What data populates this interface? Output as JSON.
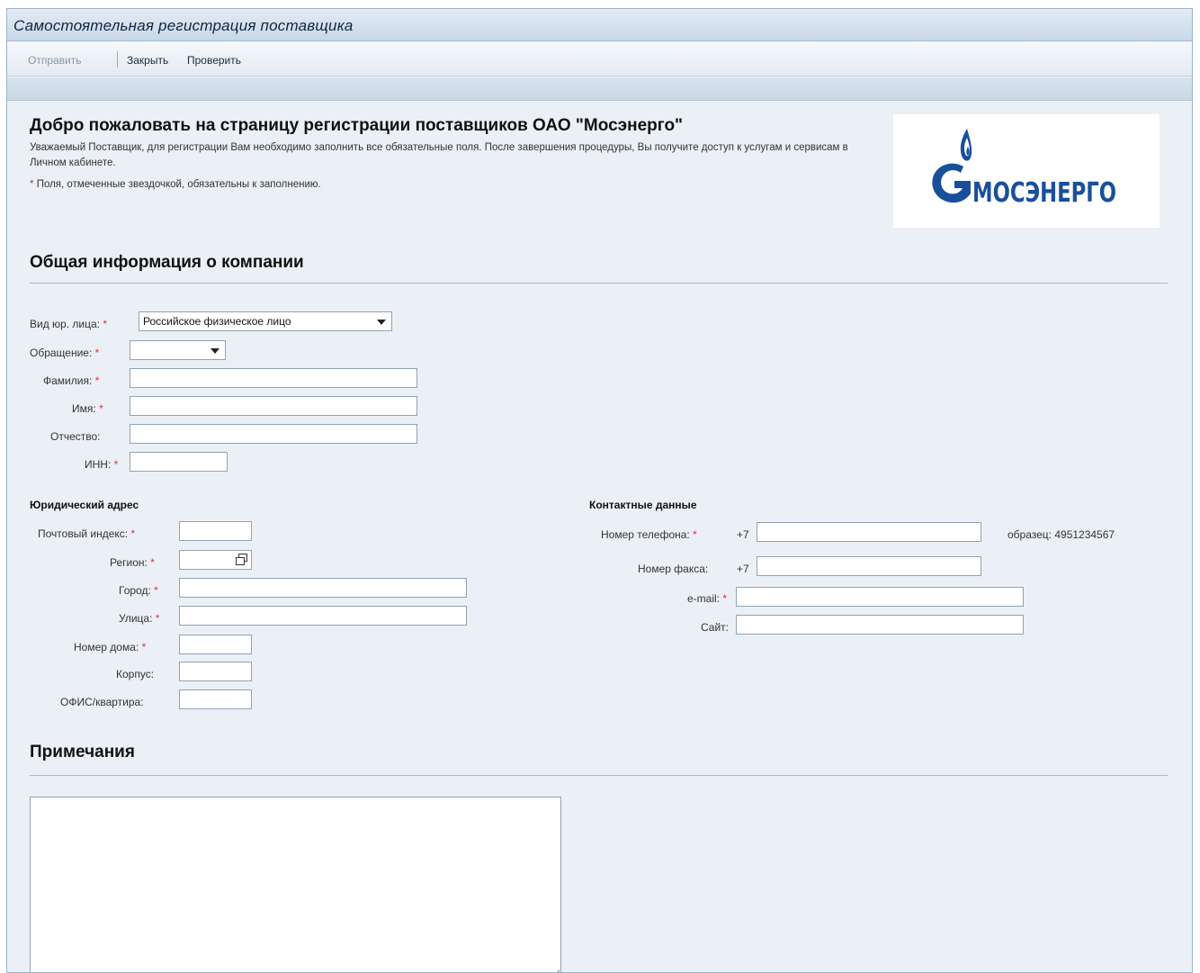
{
  "window": {
    "title": "Самостоятельная регистрация поставщика"
  },
  "toolbar": {
    "send": "Отправить",
    "close": "Закрыть",
    "check": "Проверить"
  },
  "welcome": {
    "title": "Добро пожаловать на страницу регистрации поставщиков ОАО \"Мосэнерго\"",
    "text": "Уважаемый Поставщик, для регистрации Вам необходимо заполнить все обязательные поля. После завершения процедуры, Вы получите доступ к услугам и сервисам в Личном кабинете.",
    "required_note": "Поля, отмеченные звездочкой, обязательны к заполнению.",
    "star": "*"
  },
  "logo": {
    "text": "МОСЭНЕРГО"
  },
  "company": {
    "section_title": "Общая информация о компании",
    "entity_type_label": "Вид юр. лица:",
    "entity_type_value": "Российское физическое лицо",
    "salutation_label": "Обращение:",
    "salutation_value": "",
    "lastname_label": "Фамилия:",
    "firstname_label": "Имя:",
    "middlename_label": "Отчество:",
    "inn_label": "ИНН:"
  },
  "address": {
    "title": "Юридический адрес",
    "postcode_label": "Почтовый индекс:",
    "region_label": "Регион:",
    "city_label": "Город:",
    "street_label": "Улица:",
    "house_label": "Номер дома:",
    "building_label": "Корпус:",
    "office_label": "ОФИС/квартира:"
  },
  "contacts": {
    "title": "Контактные данные",
    "phone_label": "Номер телефона:",
    "phone_prefix": "+7",
    "phone_hint": "образец: 4951234567",
    "fax_label": "Номер факса:",
    "fax_prefix": "+7",
    "email_label": "e-mail:",
    "site_label": "Сайт:"
  },
  "notes": {
    "section_title": "Примечания"
  },
  "colors": {
    "accent": "#1a4f9c",
    "background": "#ebf0f6",
    "required": "#dd3333"
  }
}
